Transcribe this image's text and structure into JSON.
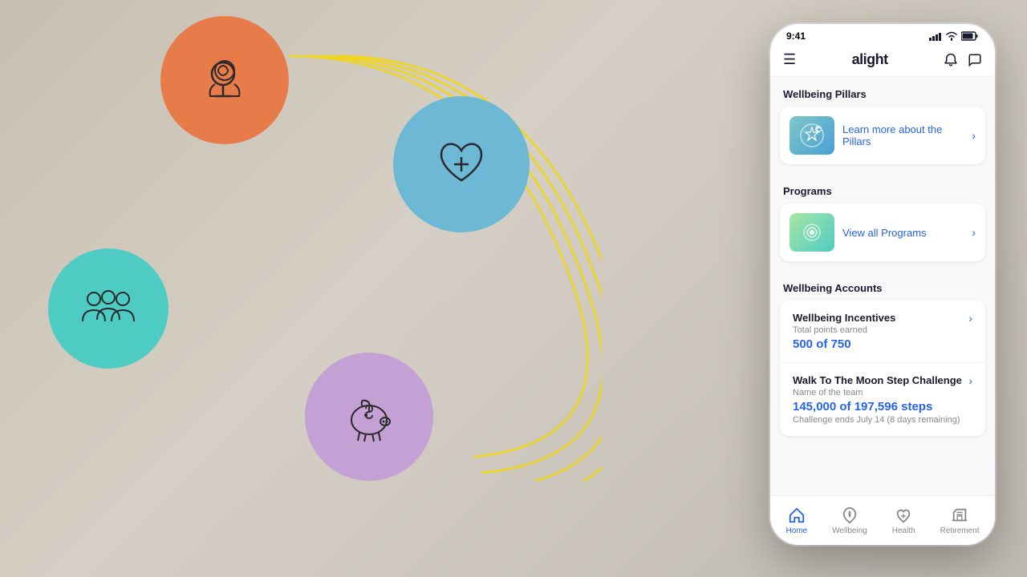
{
  "background": {
    "color": "#d0c9bf"
  },
  "phone": {
    "status_bar": {
      "time": "9:41",
      "signal": "●●●●",
      "wifi": "wifi",
      "battery": "battery"
    },
    "nav": {
      "menu_icon": "☰",
      "logo": "alight",
      "bell_icon": "🔔",
      "chat_icon": "💬"
    },
    "wellbeing_pillars": {
      "section_label": "Wellbeing Pillars",
      "card_link": "Learn more about the Pillars"
    },
    "programs": {
      "section_label": "Programs",
      "card_link": "View all Programs"
    },
    "wellbeing_accounts": {
      "section_label": "Wellbeing Accounts",
      "incentives": {
        "title": "Wellbeing Incentives",
        "subtitle": "Total points earned",
        "value": "500 of 750"
      },
      "step_challenge": {
        "title": "Walk To The Moon Step Challenge",
        "subtitle": "Name of the team",
        "value": "145,000 of 197,596 steps",
        "note": "Challenge ends July 14 (8 days remaining)"
      }
    },
    "bottom_nav": {
      "items": [
        {
          "id": "home",
          "label": "Home",
          "active": true
        },
        {
          "id": "wellbeing",
          "label": "Wellbeing",
          "active": false
        },
        {
          "id": "health",
          "label": "Health",
          "active": false
        },
        {
          "id": "retirement",
          "label": "Retirement",
          "active": false
        }
      ]
    }
  },
  "circles": {
    "brain": {
      "color": "#e87b4a"
    },
    "health": {
      "color": "#6db8d4"
    },
    "team": {
      "color": "#4eccc4"
    },
    "piggy": {
      "color": "#c4a0d4"
    }
  }
}
